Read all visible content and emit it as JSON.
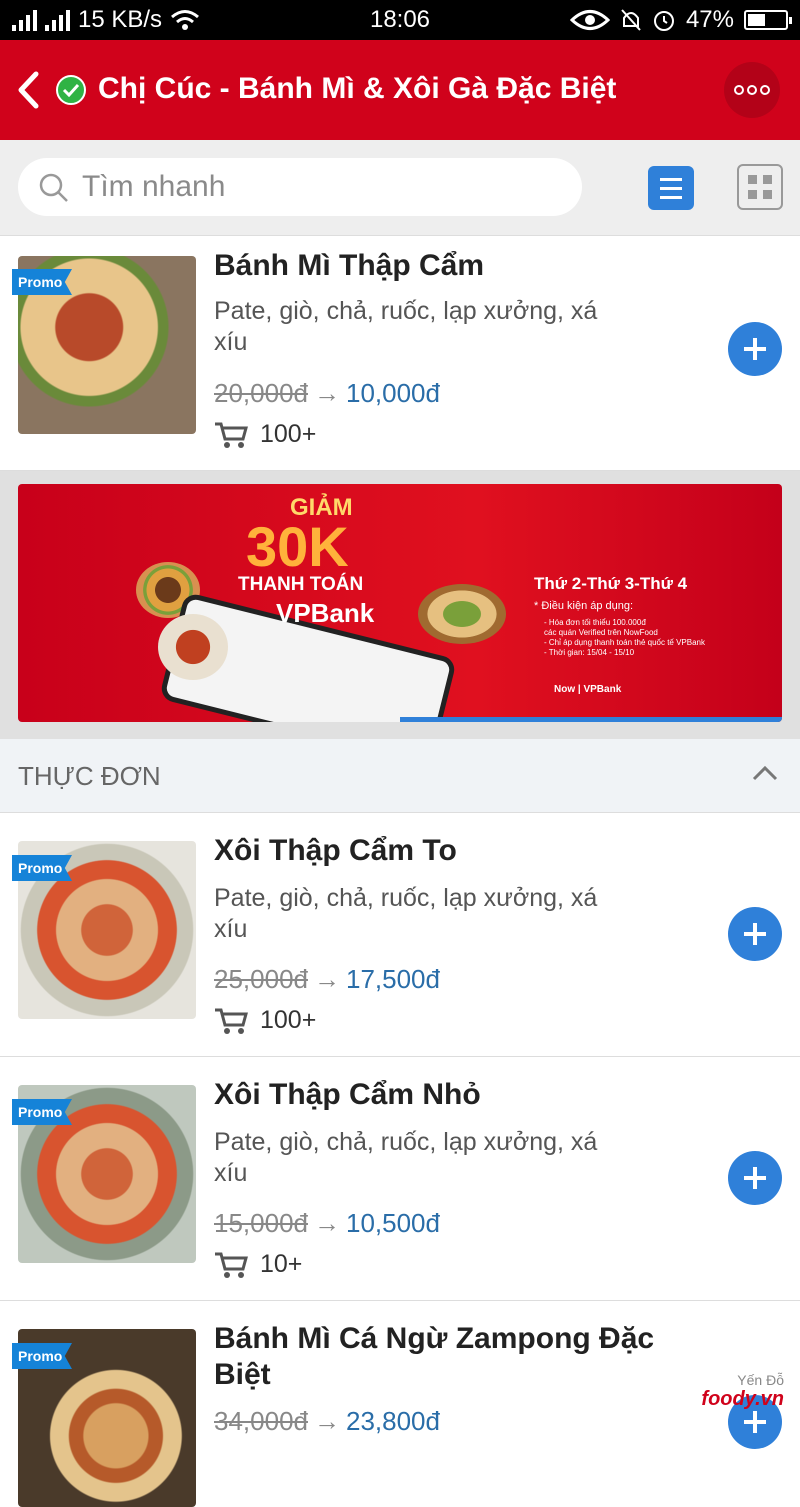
{
  "status_bar": {
    "network_speed": "15 KB/s",
    "time": "18:06",
    "battery": "47%",
    "battery_level": 0.47
  },
  "header": {
    "title": "Chị Cúc - Bánh Mì & Xôi Gà Đặc Biệt",
    "verified": true
  },
  "search": {
    "placeholder": "Tìm nhanh",
    "value": ""
  },
  "promo_label": "Promo",
  "featured_item": {
    "name": "Bánh Mì Thập Cẩm",
    "description": "Pate, giò, chả, ruốc, lạp xưởng, xá xíu",
    "old_price": "20,000đ",
    "new_price": "10,000đ",
    "sold": "100+"
  },
  "banner": {
    "headline": "GIẢM",
    "amount": "30K",
    "payment": "THANH TOÁN",
    "bank": "VPBank",
    "days": "Thứ 2-Thứ 3-Thứ 4",
    "conditions_title": "* Điều kiện áp dụng:",
    "conditions": [
      "- Hóa đơn tối thiểu 100.000đ",
      "  các quán Verified trên NowFood",
      "- Chỉ áp dụng thanh toán thẻ quốc tế VPBank",
      "- Thời gian: 15/04 - 15/10"
    ],
    "logos": "Now  |  VPBank"
  },
  "section": {
    "title": "THỰC ĐƠN"
  },
  "menu_items": [
    {
      "name": "Xôi Thập Cẩm To",
      "description": "Pate, giò, chả, ruốc, lạp xưởng, xá xíu",
      "old_price": "25,000đ",
      "new_price": "17,500đ",
      "sold": "100+"
    },
    {
      "name": "Xôi Thập Cẩm Nhỏ",
      "description": "Pate, giò, chả, ruốc, lạp xưởng, xá xíu",
      "old_price": "15,000đ",
      "new_price": "10,500đ",
      "sold": "10+"
    },
    {
      "name": "Bánh Mì Cá Ngừ Zampong Đặc Biệt",
      "description": "",
      "old_price": "34,000đ",
      "new_price": "23,800đ",
      "sold": ""
    }
  ],
  "watermark": {
    "author": "Yến Đỗ",
    "brand": "foody.vn"
  },
  "colors": {
    "primary_red": "#d0021b",
    "accent_blue": "#2f80d9",
    "price_blue": "#2a6da8",
    "promo_blue": "#1583d8"
  },
  "icons": [
    "back-arrow-icon",
    "verified-check-icon",
    "more-icon",
    "search-icon",
    "list-view-icon",
    "grid-view-icon",
    "cart-icon",
    "plus-icon",
    "chevron-up-icon"
  ]
}
